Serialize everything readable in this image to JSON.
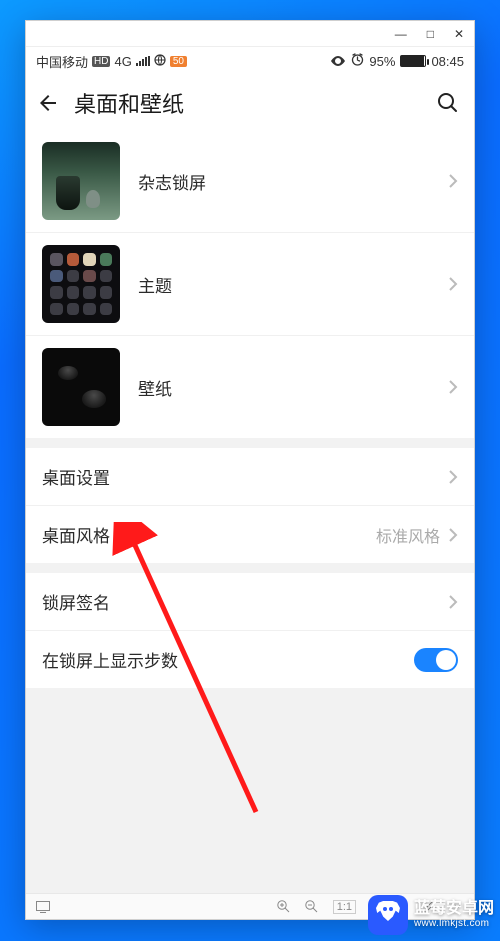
{
  "statusbar": {
    "carrier": "中国移动",
    "hd": "HD",
    "net": "4G",
    "signal_icon": "signal-icon",
    "orange": "50",
    "eye_icon": "eye-icon",
    "alarm_icon": "alarm-icon",
    "battery_pct": "95%",
    "time": "08:45"
  },
  "header": {
    "title": "桌面和壁纸"
  },
  "rows": {
    "magazine": "杂志锁屏",
    "theme": "主题",
    "wallpaper": "壁纸",
    "home_settings": "桌面设置",
    "home_style_label": "桌面风格",
    "home_style_value": "标准风格",
    "lock_signature": "锁屏签名",
    "show_steps": "在锁屏上显示步数"
  },
  "bottombar": {
    "ratio": "1:1"
  },
  "watermark": {
    "name": "蓝莓安卓网",
    "url": "www.lmkjst.com"
  }
}
